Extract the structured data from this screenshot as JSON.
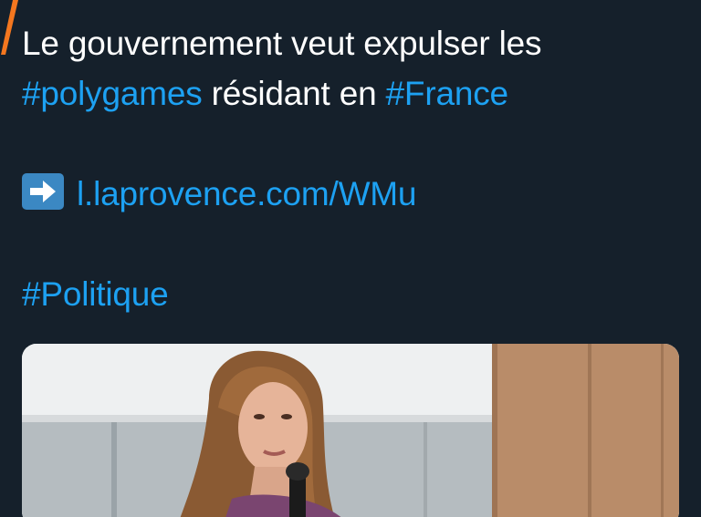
{
  "tweet": {
    "line1": "Le gouvernement veut expulser les",
    "hashtag_polygames": "#polygames",
    "text_residant": " résidant en ",
    "hashtag_france": "#France",
    "link": "l.laprovence.com/WMu",
    "hashtag_politique": "#Politique"
  },
  "icons": {
    "arrow": "right-arrow-emoji-icon",
    "mark": "orange-slash-mark"
  },
  "colors": {
    "background": "#15202b",
    "text": "#ffffff",
    "link": "#1da1f2",
    "emoji_blue": "#3b88c3",
    "orange": "#f4771f"
  },
  "media": {
    "description_icon": "photo-woman-with-microphone"
  }
}
